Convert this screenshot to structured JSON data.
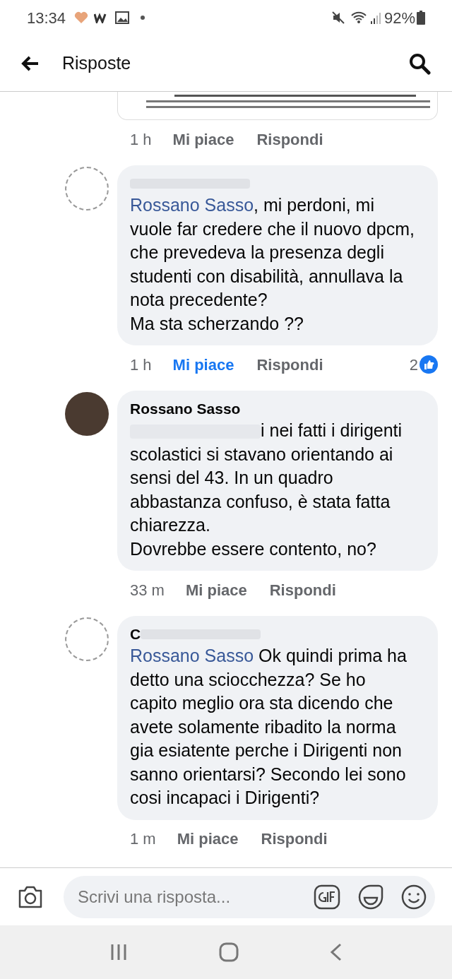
{
  "status_bar": {
    "time": "13:34",
    "battery": "92%"
  },
  "header": {
    "title": "Risposte"
  },
  "attachment": {
    "kind": "document-image"
  },
  "first_actions": {
    "time": "1 h",
    "like": "Mi piace",
    "reply": "Rispondi",
    "liked": false
  },
  "comments": [
    {
      "avatar_dark": false,
      "author_redacted": true,
      "mention": "Rossano Sasso",
      "mention_redacted": false,
      "text": ", mi perdoni, mi vuole far credere che il nuovo dpcm, che prevedeva la presenza degli studenti con disabilità, annullava la nota precedente?\nMa sta scherzando ??",
      "time": "1 h",
      "like": "Mi piace",
      "reply": "Rispondi",
      "liked": true,
      "reactions": "2"
    },
    {
      "avatar_dark": true,
      "author": "Rossano Sasso",
      "author_redacted": false,
      "mention_redacted": true,
      "text": "i nei fatti i dirigenti scolastici si stavano orientando ai sensi del 43. In un quadro abbastanza confuso, è stata fatta chiarezza.\nDovrebbe essere contento, no?",
      "time": "33 m",
      "like": "Mi piace",
      "reply": "Rispondi",
      "liked": false
    },
    {
      "avatar_dark": false,
      "author": "C",
      "author_redacted": true,
      "mention": "Rossano Sasso",
      "mention_redacted": false,
      "text": " Ok quindi prima ha detto una sciocchezza? Se ho capito meglio ora sta dicendo che avete solamente ribadito la norma gia esiatente perche i Dirigenti non sanno orientarsi? Secondo lei sono cosi incapaci i Dirigenti?",
      "time": "1 m",
      "like": "Mi piace",
      "reply": "Rispondi",
      "liked": false
    }
  ],
  "composer": {
    "placeholder": "Scrivi una risposta..."
  }
}
